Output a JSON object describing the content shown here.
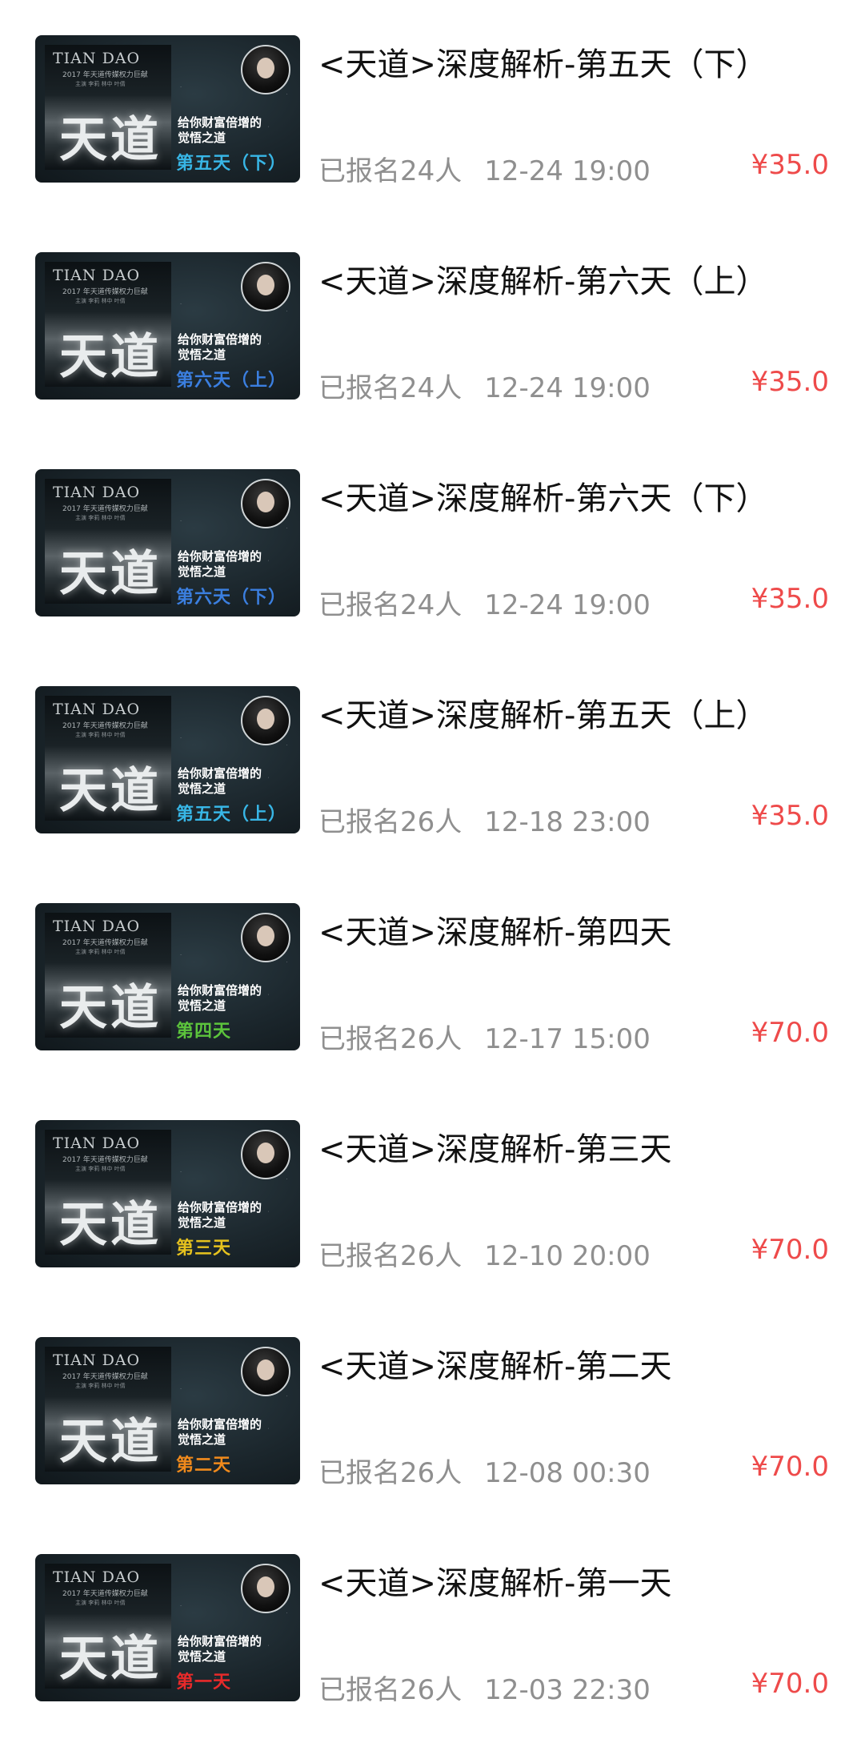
{
  "thumbnail": {
    "poster_title": "TIAN DAO",
    "poster_sub": "2017 年天道传媒权力巨献",
    "poster_sub2": "主演 李莉 林中 叶倩",
    "poster_big": "天道",
    "slogan_line1": "给你财富倍增的",
    "slogan_line2": "觉悟之道"
  },
  "courses": [
    {
      "title": "<天道>深度解析-第五天（下）",
      "signup": "已报名24人",
      "time": "12-24 19:00",
      "price": "¥35.0",
      "day_label": "第五天（下）",
      "day_color": "#38b6e6"
    },
    {
      "title": "<天道>深度解析-第六天（上）",
      "signup": "已报名24人",
      "time": "12-24 19:00",
      "price": "¥35.0",
      "day_label": "第六天（上）",
      "day_color": "#3b7fe0"
    },
    {
      "title": "<天道>深度解析-第六天（下）",
      "signup": "已报名24人",
      "time": "12-24 19:00",
      "price": "¥35.0",
      "day_label": "第六天（下）",
      "day_color": "#3b7fe0"
    },
    {
      "title": "<天道>深度解析-第五天（上）",
      "signup": "已报名26人",
      "time": "12-18 23:00",
      "price": "¥35.0",
      "day_label": "第五天（上）",
      "day_color": "#38b6e6"
    },
    {
      "title": "<天道>深度解析-第四天",
      "signup": "已报名26人",
      "time": "12-17 15:00",
      "price": "¥70.0",
      "day_label": "第四天",
      "day_color": "#5cc43c"
    },
    {
      "title": "<天道>深度解析-第三天",
      "signup": "已报名26人",
      "time": "12-10 20:00",
      "price": "¥70.0",
      "day_label": "第三天",
      "day_color": "#e6c21e"
    },
    {
      "title": "<天道>深度解析-第二天",
      "signup": "已报名26人",
      "time": "12-08 00:30",
      "price": "¥70.0",
      "day_label": "第二天",
      "day_color": "#f08a1c"
    },
    {
      "title": "<天道>深度解析-第一天",
      "signup": "已报名26人",
      "time": "12-03 22:30",
      "price": "¥70.0",
      "day_label": "第一天",
      "day_color": "#e82a2a"
    }
  ]
}
